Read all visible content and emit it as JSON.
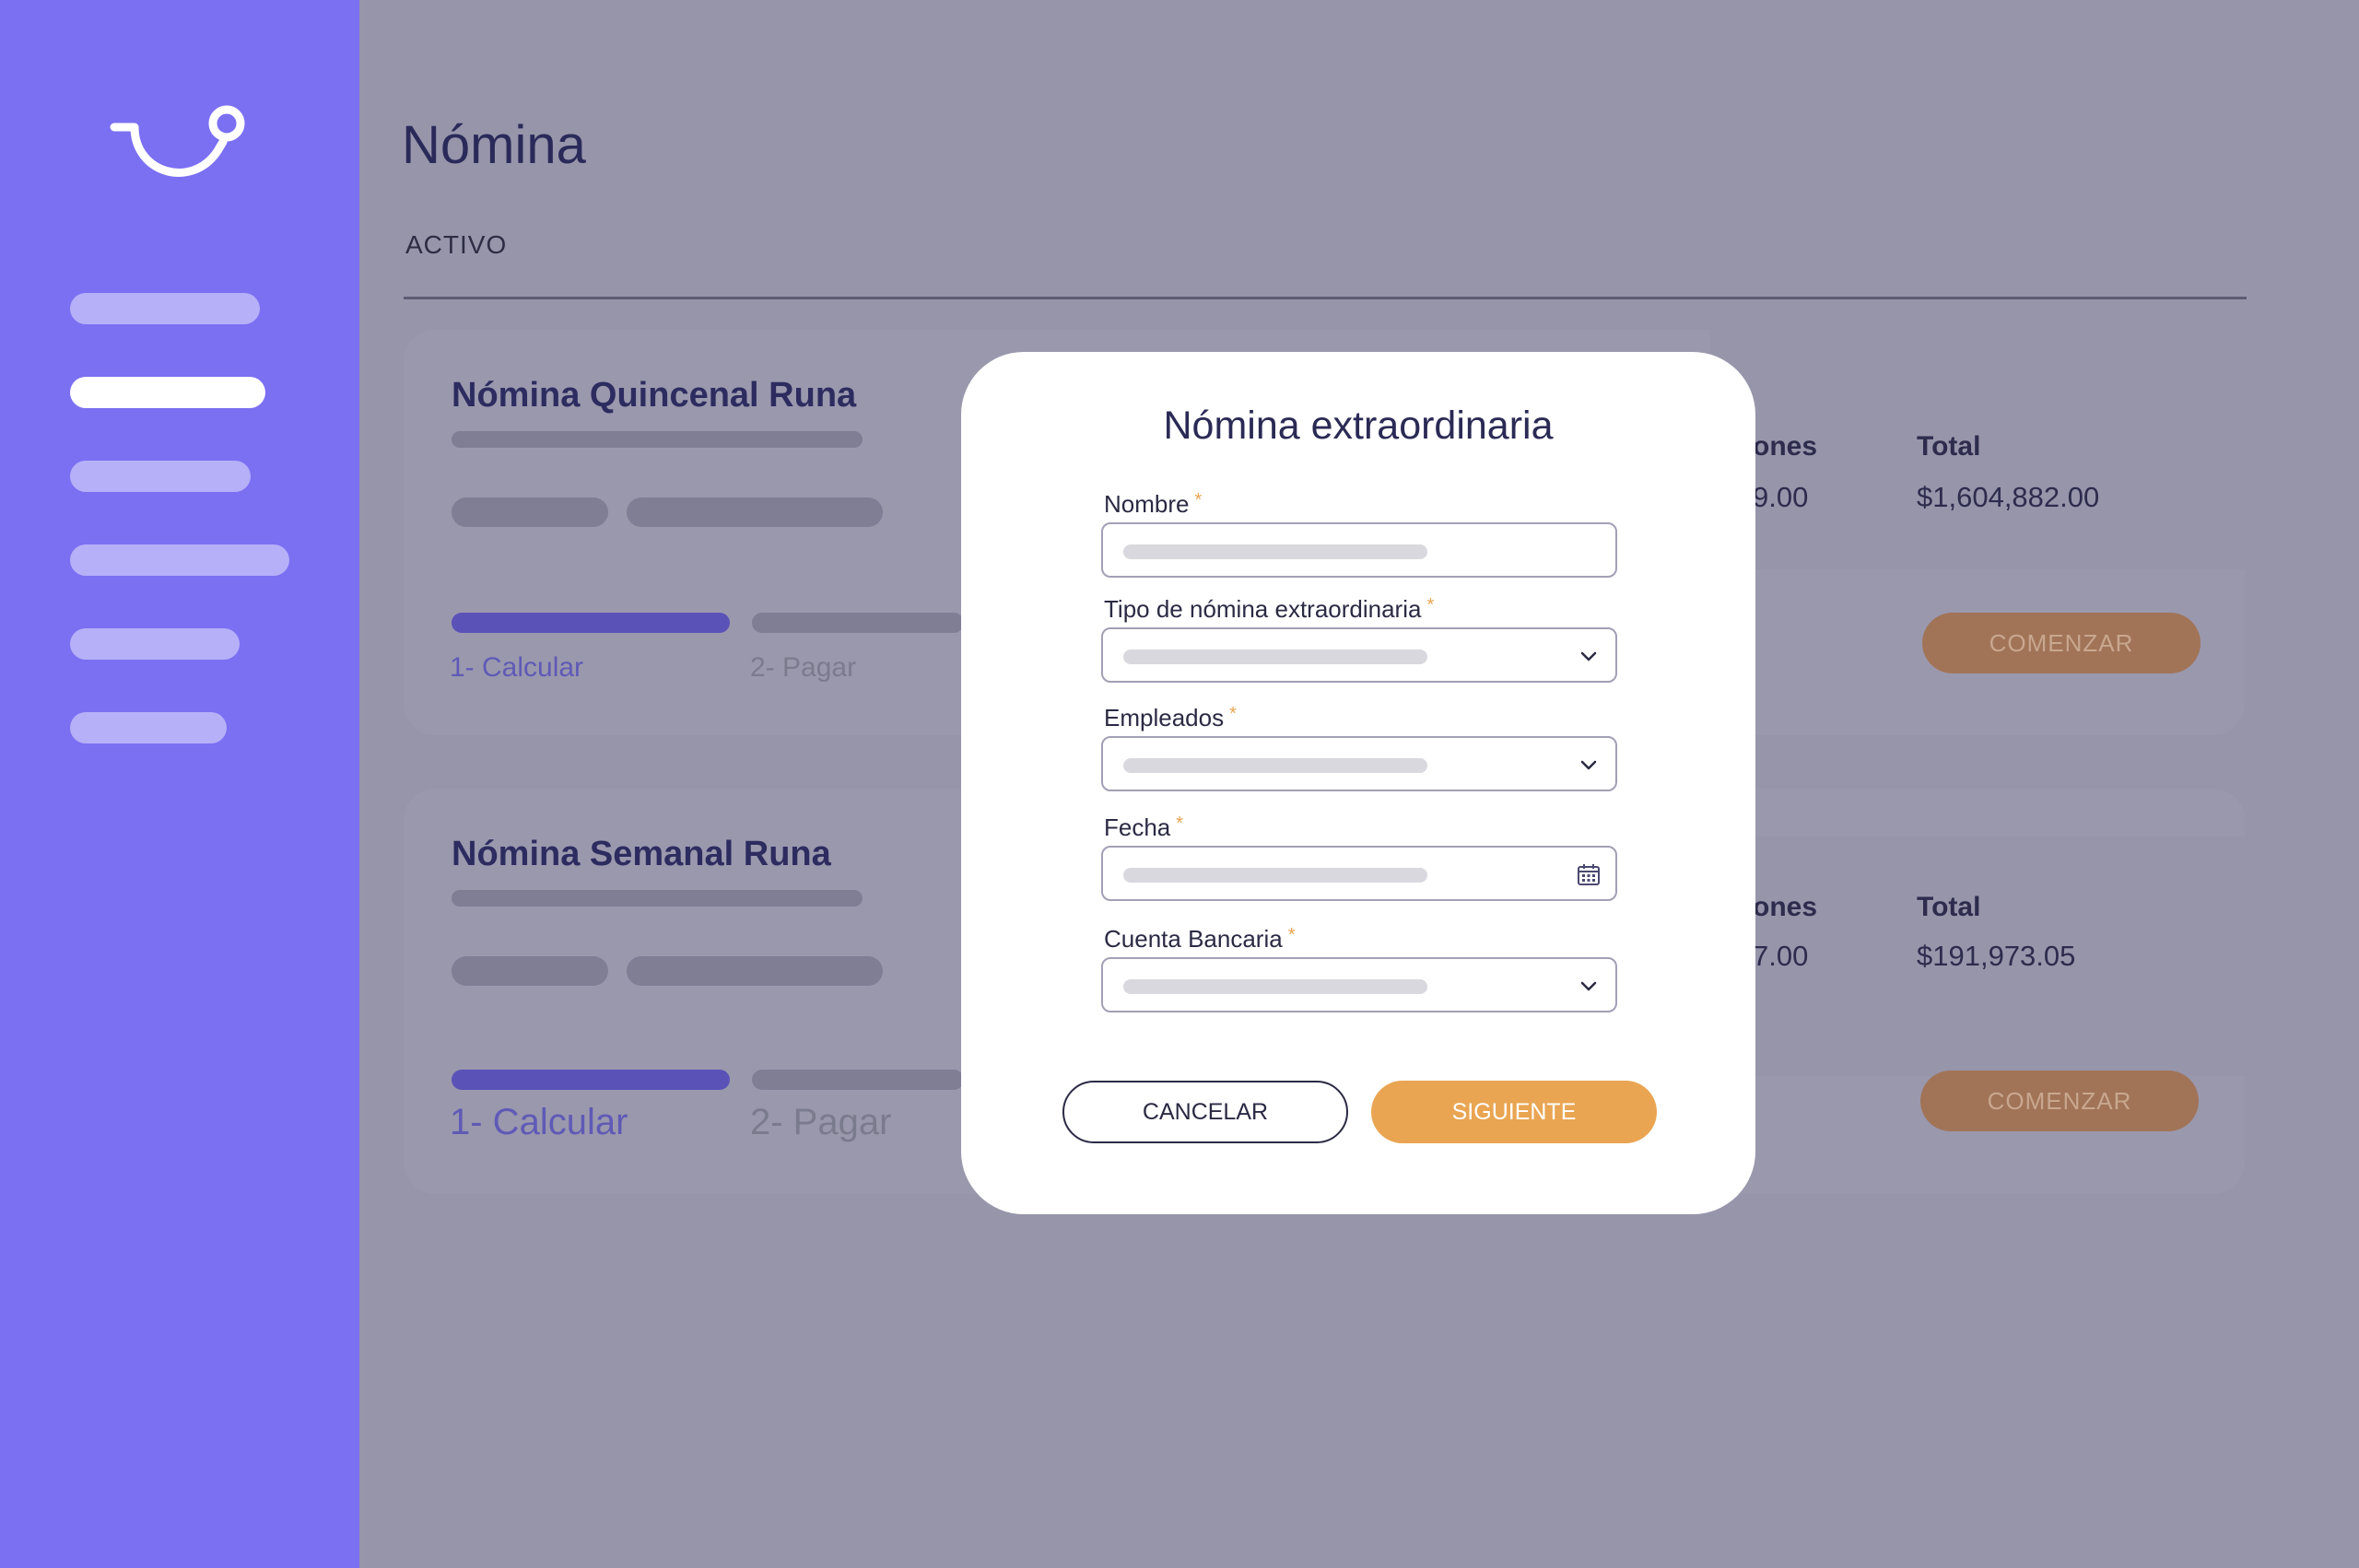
{
  "app": {
    "logo_icon": "smile-logo-icon"
  },
  "sidebar": {
    "items": [
      {
        "icon": "nav-placeholder"
      },
      {
        "icon": "nav-placeholder-active"
      },
      {
        "icon": "nav-placeholder"
      },
      {
        "icon": "nav-placeholder"
      },
      {
        "icon": "nav-placeholder"
      },
      {
        "icon": "nav-placeholder"
      }
    ]
  },
  "page": {
    "title": "Nómina",
    "tab": "ACTIVO"
  },
  "cards": [
    {
      "title": "Nómina Quincenal Runa",
      "steps": [
        "1- Calcular",
        "2- Pagar"
      ],
      "col_partial": "ones",
      "col_partial_value": "9.00",
      "total_label": "Total",
      "total_value": "$1,604,882.00",
      "button": "COMENZAR"
    },
    {
      "title": "Nómina Semanal Runa",
      "steps": [
        "1- Calcular",
        "2- Pagar"
      ],
      "col_partial": "ones",
      "col_partial_value": "7.00",
      "total_label": "Total",
      "total_value": "$191,973.05",
      "button": "COMENZAR"
    }
  ],
  "modal": {
    "title": "Nómina extraordinaria",
    "required_mark": "*",
    "fields": [
      {
        "label": "Nombre",
        "type": "text"
      },
      {
        "label": "Tipo de nómina extraordinaria",
        "type": "select"
      },
      {
        "label": "Empleados",
        "type": "select"
      },
      {
        "label": "Fecha",
        "type": "date"
      },
      {
        "label": "Cuenta Bancaria",
        "type": "select"
      }
    ],
    "cancel": "CANCELAR",
    "next": "SIGUIENTE"
  },
  "colors": {
    "sidebar": "#7b6ff2",
    "accent": "#e9a552",
    "overlay": "#9795aa",
    "primary_text": "#2b2a55"
  }
}
